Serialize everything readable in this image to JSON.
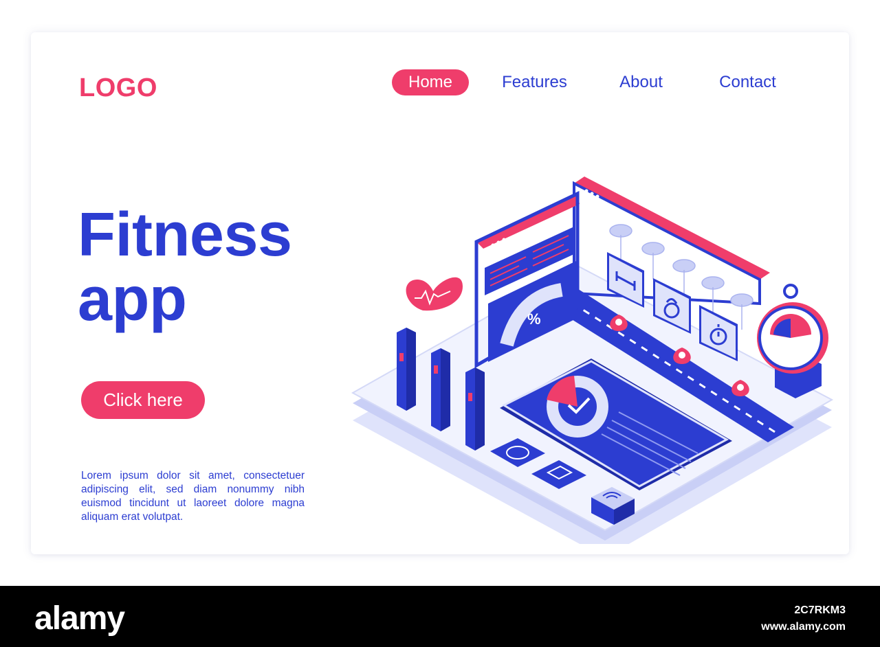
{
  "header": {
    "logo": "LOGO",
    "nav": [
      {
        "label": "Home",
        "active": true
      },
      {
        "label": "Features",
        "active": false
      },
      {
        "label": "About",
        "active": false
      },
      {
        "label": "Contact",
        "active": false
      }
    ]
  },
  "hero": {
    "title_line1": "Fitness",
    "title_line2": "app",
    "cta_label": "Click here",
    "description": "Lorem ipsum dolor sit amet, consectetuer adipiscing elit, sed diam nonummy nibh euismod tincidunt ut laoreet dolore magna aliquam erat volutpat."
  },
  "illustration": {
    "gauge_symbol": "%",
    "icons": [
      "heart-pulse-icon",
      "dumbbell-icon",
      "kettlebell-icon",
      "stopwatch-icon",
      "wifi-icon",
      "location-pin-icon",
      "clock-icon",
      "treadmill-icon"
    ]
  },
  "footer": {
    "brand": "alamy",
    "image_id": "2C7RKM3",
    "site": "www.alamy.com"
  },
  "colors": {
    "primary_blue": "#2c3dd1",
    "accent_pink": "#ef3d6b",
    "light_lavender": "#dfe3fb"
  }
}
